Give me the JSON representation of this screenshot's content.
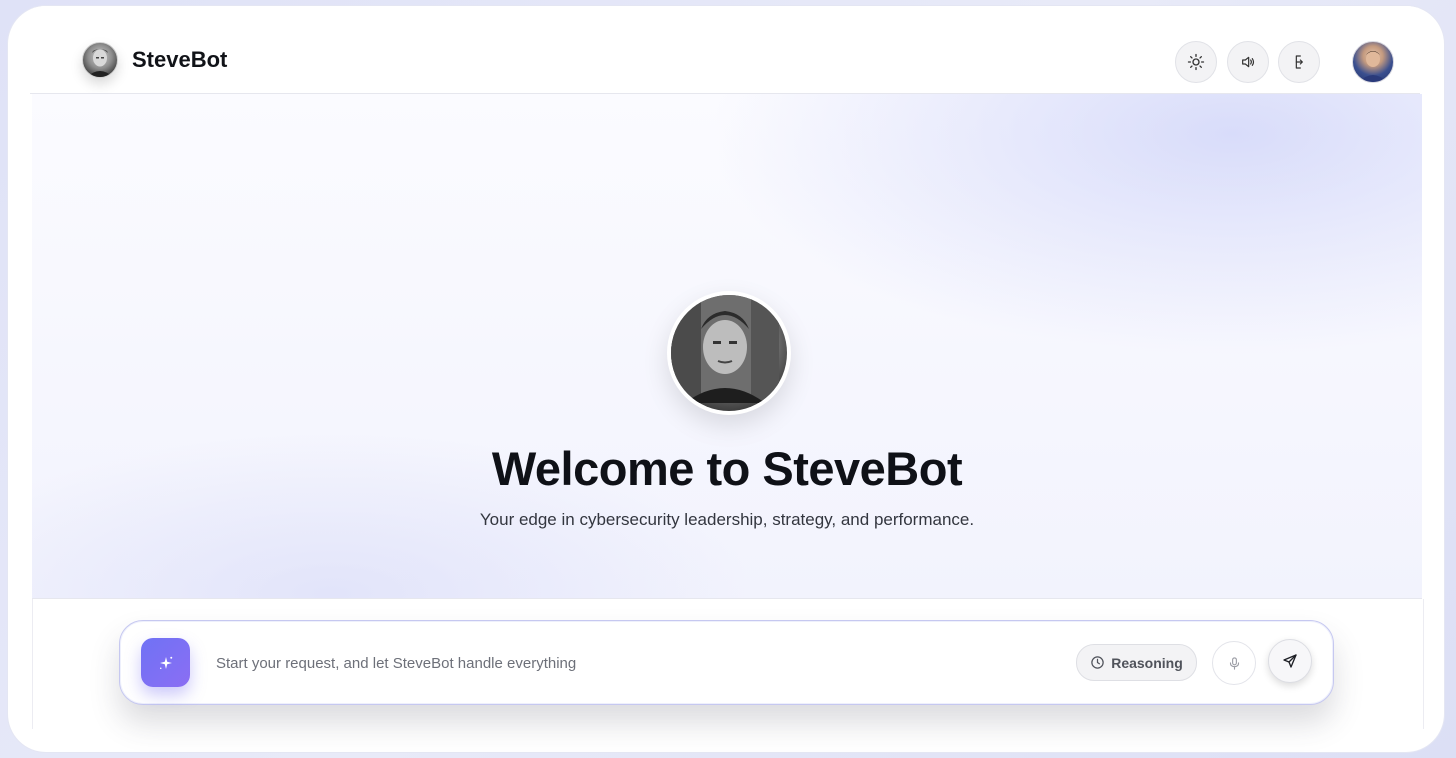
{
  "brand": {
    "name": "SteveBot",
    "avatar_icon": "steve-avatar"
  },
  "header": {
    "buttons": [
      {
        "name": "theme-toggle-button",
        "icon": "sun-icon"
      },
      {
        "name": "audio-button",
        "icon": "speaker-icon"
      },
      {
        "name": "layout-button",
        "icon": "split-icon"
      }
    ],
    "user_avatar_icon": "user-avatar"
  },
  "hero": {
    "title": "Welcome to SteveBot",
    "subtitle": "Your edge in cybersecurity leadership, strategy, and performance."
  },
  "composer": {
    "placeholder": "Start your request, and let SteveBot handle everything",
    "reasoning_label": "Reasoning"
  },
  "colors": {
    "accent": "#6f72f5",
    "accent_end": "#8b6ef3",
    "border_accent": "#c6c8f0"
  }
}
